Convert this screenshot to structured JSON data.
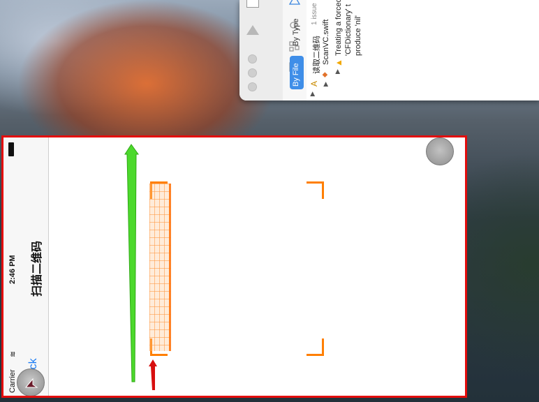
{
  "xcode": {
    "tabs": {
      "by_file": "By File",
      "by_type": "By Type"
    },
    "tree": {
      "project": "读取二维码",
      "project_count": "1 issue",
      "file": "ScanVC.swift",
      "warning": "Treating a forced",
      "warning_line2": "'CFDictionary' t",
      "warning_line3": "produce 'nil'"
    }
  },
  "phone": {
    "status": {
      "carrier": "Carrier",
      "time": "2:46 PM"
    },
    "nav": {
      "back": "Back",
      "title": "扫描二维码"
    }
  },
  "colors": {
    "highlight_border": "#e30d0d",
    "scan_corner": "#ff7f00",
    "back_tint": "#1a7cf5",
    "annotation_green": "#4cd92c",
    "annotation_red": "#d70f0f"
  }
}
